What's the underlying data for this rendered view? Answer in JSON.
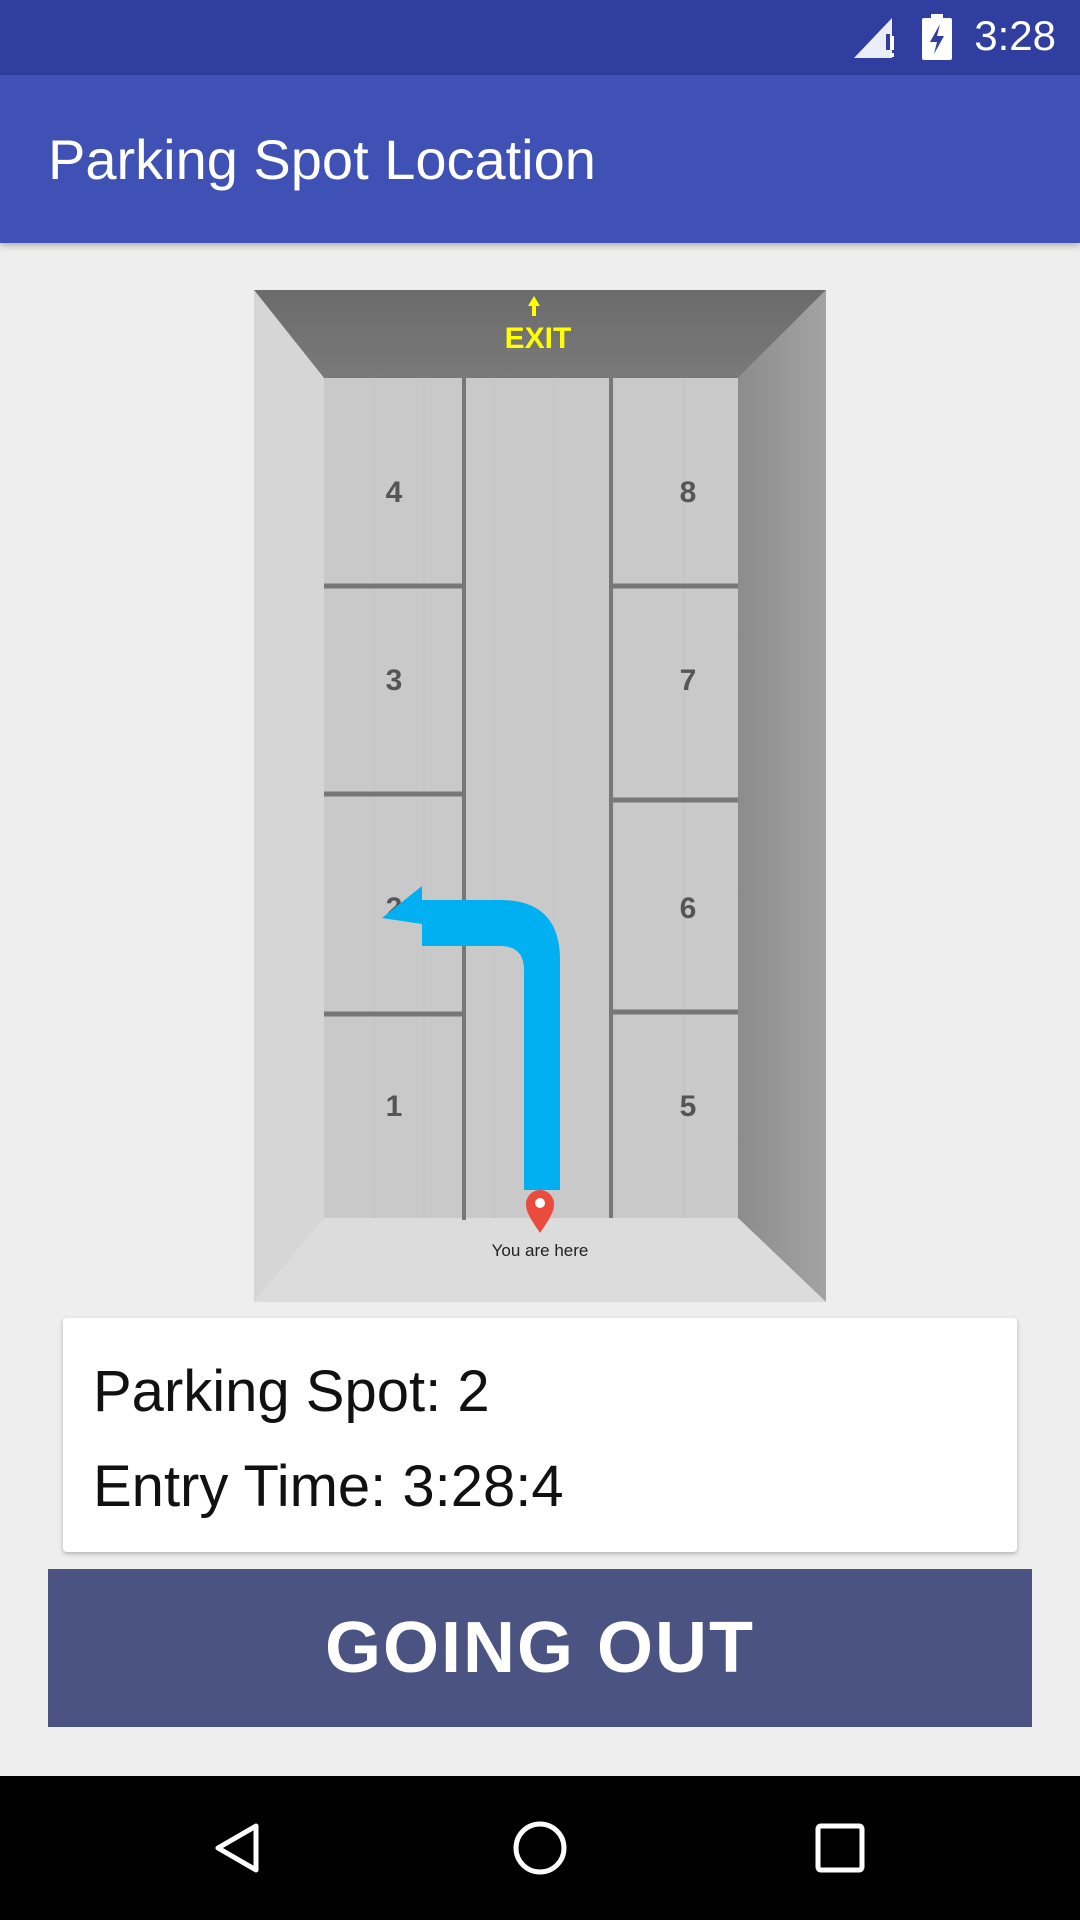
{
  "status_bar": {
    "time": "3:28"
  },
  "app_bar": {
    "title": "Parking Spot Location"
  },
  "map": {
    "exit_label": "EXIT",
    "spots_left": [
      "4",
      "3",
      "2",
      "1"
    ],
    "spots_right": [
      "8",
      "7",
      "6",
      "5"
    ],
    "you_are_here": "You are here",
    "arrow_color": "#00b0f0",
    "exit_color": "#ffff00",
    "pin_color": "#e94b3c"
  },
  "info": {
    "parking_spot": "Parking Spot: 2",
    "entry_time": "Entry Time: 3:28:4"
  },
  "actions": {
    "going_out_label": "GOING OUT"
  },
  "colors": {
    "status_bar": "#2f3e9f",
    "app_bar": "#3f51b5",
    "button": "#4a5382"
  },
  "icons": {
    "signal": "signal-icon",
    "battery": "battery-icon",
    "nav_back": "back-icon",
    "nav_home": "home-icon",
    "nav_recent": "recents-icon"
  }
}
